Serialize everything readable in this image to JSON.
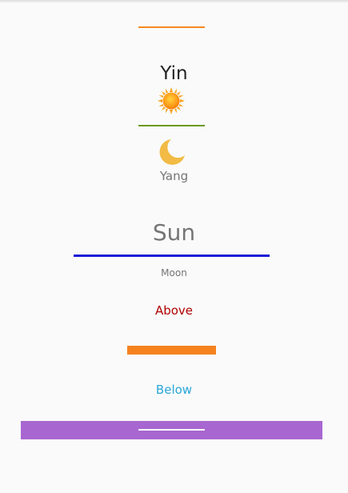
{
  "yin_yang": {
    "yin_label": "Yin",
    "yang_label": "Yang",
    "top_divider_color": "#f5891f",
    "middle_divider_color": "#6b9a1e",
    "sun_icon": "sun-icon",
    "moon_icon": "crescent-moon-icon"
  },
  "sun_moon": {
    "sun_label": "Sun",
    "moon_label": "Moon",
    "divider_color": "#1a1ad6"
  },
  "above_below": {
    "above_label": "Above",
    "below_label": "Below",
    "above_color": "#b00000",
    "below_color": "#2aa6d8",
    "orange_bar_color": "#f5821f",
    "purple_bar_color": "#a866d0",
    "white_line_color": "#ffffff"
  }
}
